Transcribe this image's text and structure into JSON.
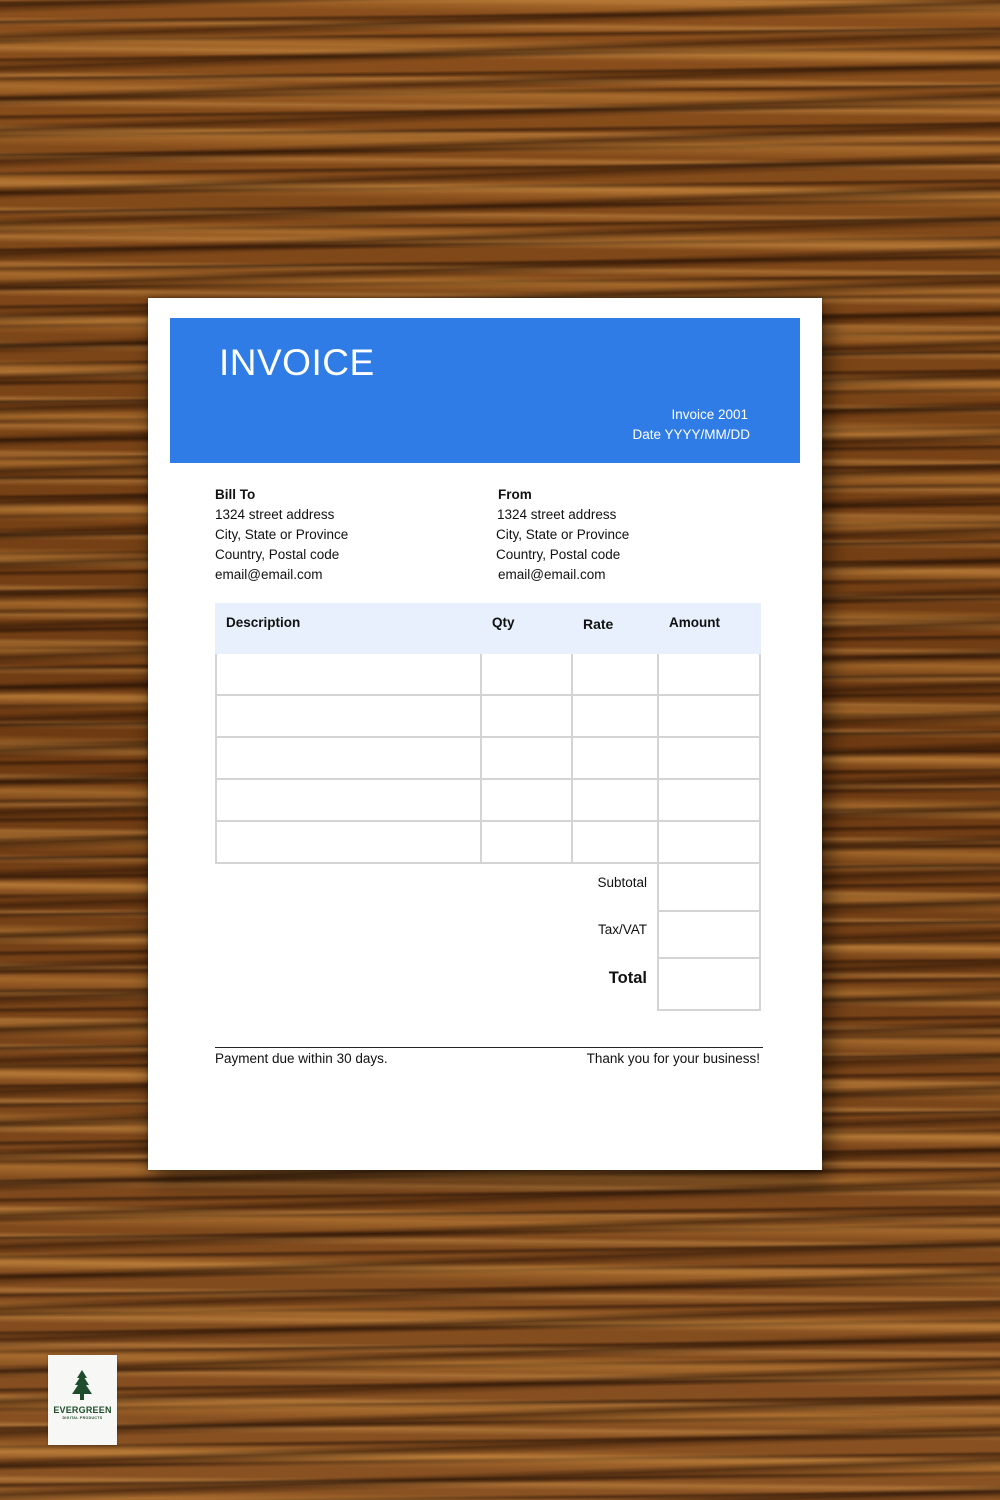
{
  "invoice": {
    "title": "INVOICE",
    "number": "Invoice 2001",
    "date": "Date YYYY/MM/DD",
    "header_color": "#2f7ce6"
  },
  "bill_to": {
    "heading": "Bill To",
    "street": "1324 street address",
    "city": "City, State or Province",
    "country": "Country, Postal code",
    "email": "email@email.com"
  },
  "from": {
    "heading": "From",
    "street": "1324 street address",
    "city": "City, State or Province",
    "country": "Country, Postal code",
    "email": "email@email.com"
  },
  "table": {
    "columns": [
      "Description",
      "Qty",
      "Rate",
      "Amount"
    ],
    "header_color": "#e7f0fc",
    "rows": [
      [
        "",
        "",
        "",
        ""
      ],
      [
        "",
        "",
        "",
        ""
      ],
      [
        "",
        "",
        "",
        ""
      ],
      [
        "",
        "",
        "",
        ""
      ],
      [
        "",
        "",
        "",
        ""
      ]
    ]
  },
  "totals": {
    "subtotal_label": "Subtotal",
    "tax_label": "Tax/VAT",
    "total_label": "Total",
    "subtotal_value": "",
    "tax_value": "",
    "total_value": ""
  },
  "footer": {
    "left": "Payment due within 30 days.",
    "right": "Thank you for your business!"
  },
  "brand": {
    "name": "EVERGREEN",
    "tagline": "DIGITAL PRODUCTS",
    "icon": "pine-tree-icon",
    "color": "#1f4d2c"
  }
}
